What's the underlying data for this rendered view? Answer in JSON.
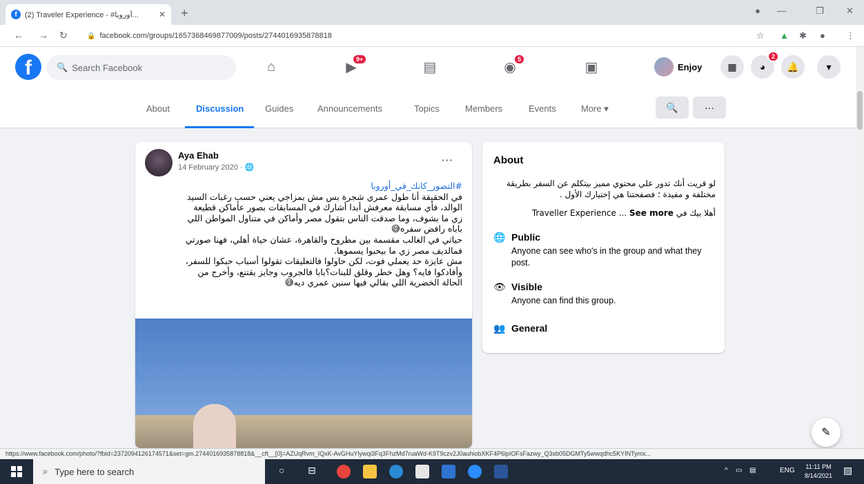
{
  "browser": {
    "tab_title": "(2) Traveler Experience - #أوروبا...",
    "tab_close": "✕",
    "new_tab": "+",
    "url": "facebook.com/groups/1657368469877009/posts/2744016935878818",
    "status_url": "https://www.facebook.com/photo/?fbid=2372094126174571&set=gm.2744016935878818&__cft__[0]=AZUqRvm_IQxK-AvGHuYlywqi3Fq3FhzMd7ruaWd-K9T9czv2J0auhiobXKF4P6lpIOFsFazwy_Q3sb05DGMTy5wwqdhc5KYINTymx..."
  },
  "fb": {
    "search_placeholder": "Search Facebook",
    "watch_badge": "9+",
    "groups_badge": "5",
    "messenger_badge": "2",
    "profile_name": "Enjoy"
  },
  "group_tabs": {
    "about": "About",
    "discussion": "Discussion",
    "guides": "Guides",
    "announcements": "Announcements",
    "topics": "Topics",
    "members": "Members",
    "events": "Events",
    "more": "More ▾",
    "overflow": "···"
  },
  "post": {
    "author": "Aya Ehab",
    "date": "14 February 2020 · 🌐",
    "more": "···",
    "hashtag": "#التصور_كانك_في_أوروبا",
    "lines": [
      "في الحقيقة أنا طول عمري شجرة بس مش بمزاجي يعني حسب رغبات السيد",
      "الوالد، فأي مسابقة معرفش أبدا أشارك في المسابقات بصور عأماكن قطيعة",
      "زي ما بشوف، وما صدقت الناس بتقول مصر وأماكن في متناول المواطن اللي",
      "باباه رافض سفره😅",
      "حياتي في الغالب مقسمة بين مطروح والقاهرة، عشان حياة أهلي، فهنا صورتي",
      "فمالديف مصر زي ما بيحبوا يسموها.",
      "مش عايزة حد يعملي فوت، لكن حاولوا فالتعليقات تقولوا أسباب حبكوا للسفر،",
      "وأفادكوا فايه؟ وهل خطر وقلق للبنات؟بابا فالجروب وجايز يقتنع، وأخرج من",
      "الحالة الخضرية اللي بقالي فيها سنين عمري ديه😅"
    ]
  },
  "about": {
    "heading": "About",
    "desc": "لو قريت أنك تدور علي محتوي مميز بيتكلم عن السفر بطريقة مختلفة و مفيدة ؛ فصفحتنا هي إختيارك الأول .",
    "welcome": "أهلا بيك في Traveller Experience ...",
    "see_more": "See more",
    "public_title": "Public",
    "public_desc": "Anyone can see who's in the group and what they post.",
    "visible_title": "Visible",
    "visible_desc": "Anyone can find this group.",
    "general_title": "General"
  },
  "taskbar": {
    "search_placeholder": "Type here to search",
    "lang": "ENG",
    "time": "11:11 PM",
    "date": "8/14/2021"
  },
  "colors": {
    "fb_blue": "#1877f2",
    "badge_red": "#e41e3f",
    "bg": "#f0f2f5"
  }
}
